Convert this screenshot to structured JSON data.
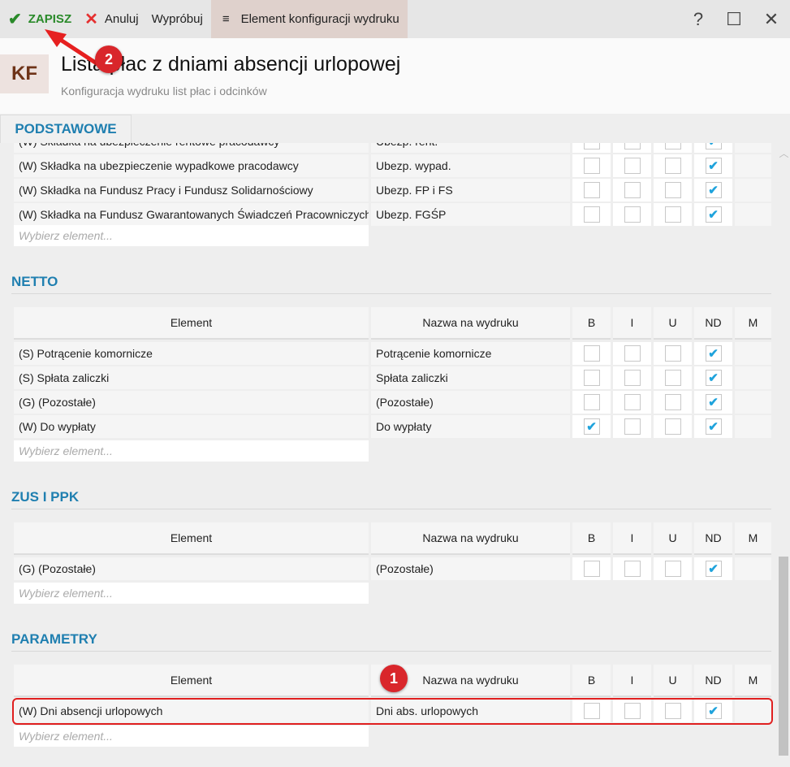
{
  "toolbar": {
    "save": "ZAPISZ",
    "cancel": "Anuluj",
    "try": "Wypróbuj",
    "menu": "Element konfiguracji wydruku"
  },
  "window": {
    "help": "?",
    "maximize": "☐",
    "close": "✕"
  },
  "header": {
    "logo": "KF",
    "title": "Lista płac z dniami absencji urlopowej",
    "subtitle": "Konfiguracja wydruku list płac i odcinków"
  },
  "tab": "PODSTAWOWE",
  "columns": {
    "element": "Element",
    "name": "Nazwa na wydruku",
    "b": "B",
    "i": "I",
    "u": "U",
    "nd": "ND",
    "m": "M"
  },
  "placeholder": "Wybierz element...",
  "sections": [
    {
      "title": "",
      "rows": [
        {
          "element": "(W) Składka na ubezpieczenie rentowe pracodawcy",
          "name": "Ubezp. rent.",
          "b": false,
          "i": false,
          "u": false,
          "nd": true
        },
        {
          "element": "(W) Składka na ubezpieczenie wypadkowe pracodawcy",
          "name": "Ubezp. wypad.",
          "b": false,
          "i": false,
          "u": false,
          "nd": true
        },
        {
          "element": "(W) Składka na Fundusz Pracy i Fundusz Solidarnościowy",
          "name": "Ubezp. FP i FS",
          "b": false,
          "i": false,
          "u": false,
          "nd": true
        },
        {
          "element": "(W) Składka na Fundusz Gwarantowanych Świadczeń Pracowniczych",
          "name": "Ubezp. FGŚP",
          "b": false,
          "i": false,
          "u": false,
          "nd": true
        }
      ]
    },
    {
      "title": "NETTO",
      "rows": [
        {
          "element": "(S) Potrącenie komornicze",
          "name": "Potrącenie komornicze",
          "b": false,
          "i": false,
          "u": false,
          "nd": true
        },
        {
          "element": "(S) Spłata zaliczki",
          "name": "Spłata zaliczki",
          "b": false,
          "i": false,
          "u": false,
          "nd": true
        },
        {
          "element": "(G) (Pozostałe)",
          "name": "(Pozostałe)",
          "b": false,
          "i": false,
          "u": false,
          "nd": true
        },
        {
          "element": "(W) Do wypłaty",
          "name": "Do wypłaty",
          "b": true,
          "i": false,
          "u": false,
          "nd": true
        }
      ]
    },
    {
      "title": "ZUS I PPK",
      "rows": [
        {
          "element": "(G) (Pozostałe)",
          "name": "(Pozostałe)",
          "b": false,
          "i": false,
          "u": false,
          "nd": true
        }
      ]
    },
    {
      "title": "PARAMETRY",
      "rows": [
        {
          "element": "(W) Dni absencji urlopowych",
          "name": "Dni abs. urlopowych",
          "b": false,
          "i": false,
          "u": false,
          "nd": true
        }
      ]
    }
  ],
  "annotations": {
    "badge1": "1",
    "badge2": "2"
  }
}
